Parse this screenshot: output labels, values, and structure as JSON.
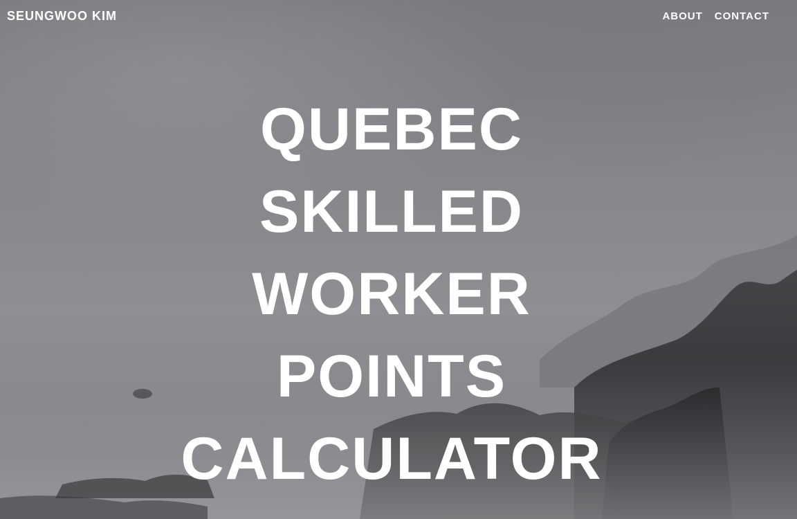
{
  "navbar": {
    "brand": "SEUNGWOO KIM",
    "links": [
      "ABOUT",
      "CONTACT"
    ]
  },
  "hero": {
    "title_lines": [
      "QUEBEC",
      "SKILLED",
      "WORKER",
      "POINTS",
      "CALCULATOR"
    ]
  },
  "colors": {
    "text": "#ffffff",
    "overlay": "#7a7c7f",
    "rocks": "#2a2b2d"
  }
}
